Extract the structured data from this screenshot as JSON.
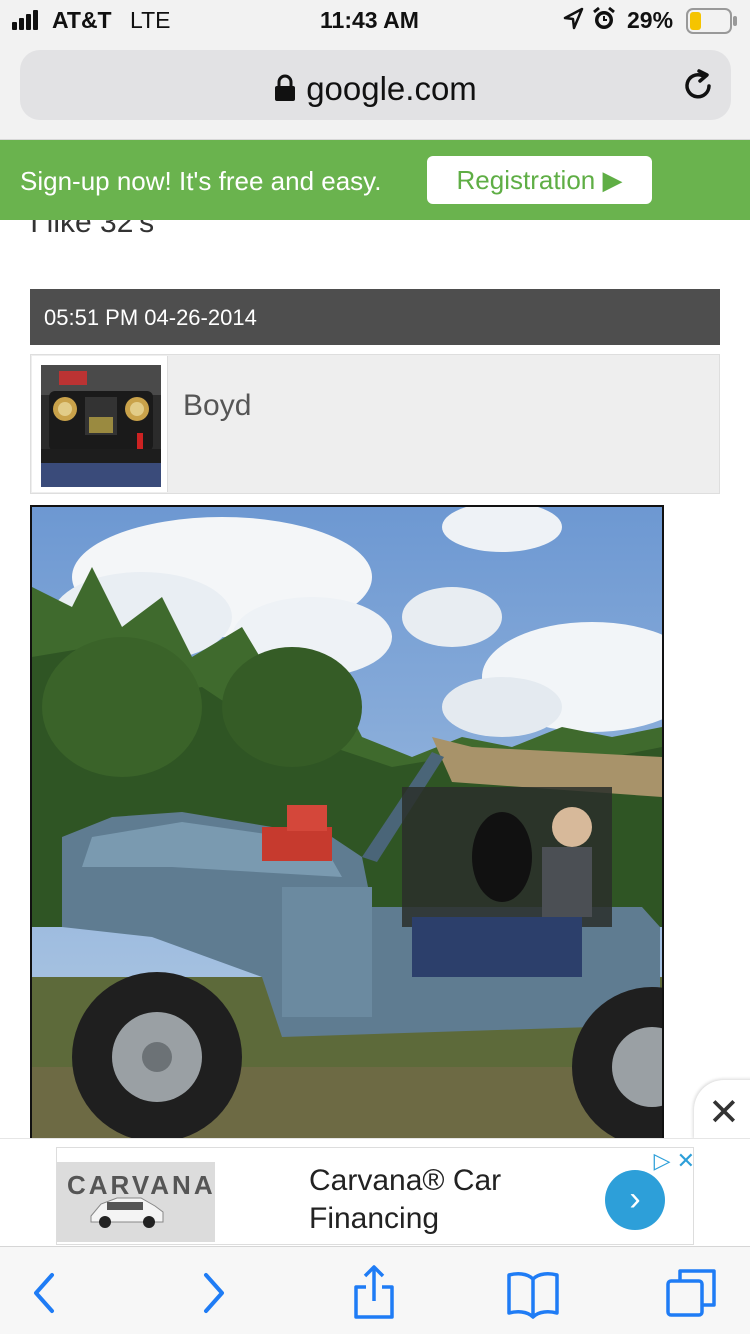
{
  "status_bar": {
    "carrier": "AT&T",
    "network": "LTE",
    "time": "11:43 AM",
    "battery": "29%",
    "battery_level": 0.29,
    "battery_color": "#f5c400"
  },
  "browser": {
    "url": "google.com",
    "lock_icon": "lock-icon",
    "reload_icon": "reload-icon"
  },
  "banner": {
    "text": "Sign-up now! It's free and easy.",
    "button_label": "Registration ▶",
    "color": "#6ab34e"
  },
  "post": {
    "partial_text": "I like 32's",
    "timestamp": "05:51 PM 04-26-2014",
    "username": "Boyd"
  },
  "ad": {
    "brand": "CARVANA",
    "title_line1": "Carvana® Car",
    "title_line2": "Financing",
    "close_label": "✕",
    "accent": "#2d9fd9"
  },
  "toolbar": {
    "items": [
      "back-icon",
      "forward-icon",
      "share-icon",
      "bookmarks-icon",
      "tabs-icon"
    ],
    "accent": "#1f7cf5"
  }
}
